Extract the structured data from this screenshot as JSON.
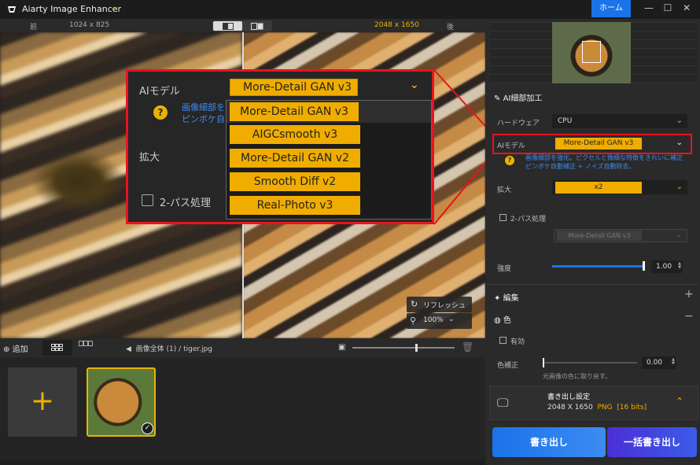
{
  "window": {
    "title": "Aiarty Image Enhancer",
    "home_label": "ホーム",
    "min": "—",
    "max": "☐",
    "close": "✕"
  },
  "infobar": {
    "before": "前",
    "res_before": "1024 x 825",
    "res_after": "2048 x 1650",
    "after": "後"
  },
  "preview": {
    "refresh": "リフレッシュ",
    "zoom": "100%"
  },
  "popup": {
    "ai_label": "AIモデル",
    "selected": "More-Detail GAN  v3",
    "desc_line1": "画像細部を",
    "desc_line2": "ピンボケ自",
    "scale_label": "拡大",
    "twopass_label": "2-パス処理",
    "options": [
      "More-Detail GAN  v3",
      "AIGCsmooth  v3",
      "More-Detail GAN  v2",
      "Smooth Diff  v2",
      "Real-Photo  v3"
    ]
  },
  "bottombar": {
    "add": "追加",
    "crumb_all": "画像全体 (1)",
    "crumb_sep": "/",
    "crumb_file": "tiger.jpg"
  },
  "panel": {
    "section_detail": "AI細部加工",
    "hardware_label": "ハードウェア",
    "hardware_value": "CPU",
    "ai_label": "AIモデル",
    "ai_value": "More-Detail GAN  v3",
    "ai_desc1": "画像細部を強化。ピクセルと微細な特徴をきれいに補正",
    "ai_desc2": "ピンボケ自動補正 + ノイズ自動除去。",
    "scale_label": "拡大",
    "scale_value": "x2",
    "twopass_label": "2-パス処理",
    "twopass_value": "More-Detail GAN  v3",
    "strength_label": "強度",
    "strength_value": "1.00",
    "section_edit": "編集",
    "section_color": "色",
    "valid_label": "有効",
    "color_label": "色補正",
    "color_value": "0.00",
    "color_hint": "元画像の色に取り戻す。",
    "export_title": "書き出し設定",
    "export_res": "2048 X 1650",
    "export_fmt": "PNG",
    "export_bits": "[16 bits]",
    "export_btn": "書き出し",
    "batch_btn": "一括書き出し"
  },
  "colors": {
    "accent": "#f0ad00",
    "blue": "#1a73e8",
    "highlight": "#e8131f"
  }
}
